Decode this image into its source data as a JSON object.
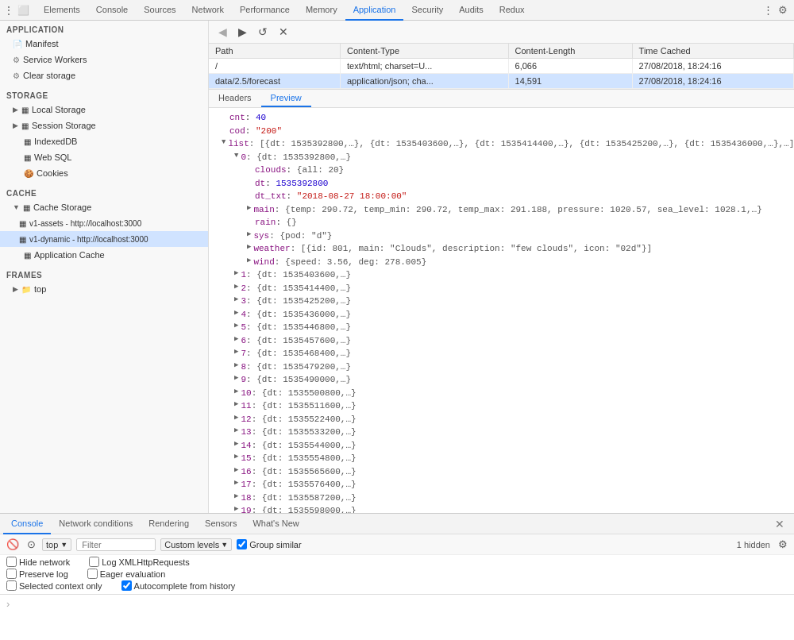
{
  "topTabs": {
    "items": [
      {
        "label": "Elements",
        "active": false
      },
      {
        "label": "Console",
        "active": false
      },
      {
        "label": "Sources",
        "active": false
      },
      {
        "label": "Network",
        "active": false
      },
      {
        "label": "Performance",
        "active": false
      },
      {
        "label": "Memory",
        "active": false
      },
      {
        "label": "Application",
        "active": true
      },
      {
        "label": "Security",
        "active": false
      },
      {
        "label": "Audits",
        "active": false
      },
      {
        "label": "Redux",
        "active": false
      }
    ]
  },
  "sidebar": {
    "applicationLabel": "Application",
    "items": [
      {
        "label": "Manifest",
        "icon": "doc",
        "indent": 0,
        "type": "app"
      },
      {
        "label": "Service Workers",
        "icon": "gear",
        "indent": 0,
        "type": "app"
      },
      {
        "label": "Clear storage",
        "icon": "gear",
        "indent": 0,
        "type": "app"
      }
    ],
    "storageLabel": "Storage",
    "storageItems": [
      {
        "label": "Local Storage",
        "icon": "db",
        "indent": 0,
        "expanded": true
      },
      {
        "label": "Session Storage",
        "icon": "db",
        "indent": 0,
        "expanded": true
      },
      {
        "label": "IndexedDB",
        "icon": "db",
        "indent": 0
      },
      {
        "label": "Web SQL",
        "icon": "db",
        "indent": 0
      },
      {
        "label": "Cookies",
        "icon": "cookie",
        "indent": 0
      }
    ],
    "cacheLabel": "Cache",
    "cacheItems": [
      {
        "label": "Cache Storage",
        "icon": "db",
        "indent": 0,
        "expanded": true
      },
      {
        "label": "v1-assets - http://localhost:3000",
        "icon": "db",
        "indent": 1
      },
      {
        "label": "v1-dynamic - http://localhost:3000",
        "icon": "db",
        "indent": 1,
        "selected": true
      },
      {
        "label": "Application Cache",
        "icon": "db",
        "indent": 0
      }
    ],
    "framesLabel": "Frames",
    "framesItems": [
      {
        "label": "top",
        "indent": 0,
        "expanded": false
      }
    ]
  },
  "cacheTable": {
    "columns": [
      "Path",
      "Content-Type",
      "Content-Length",
      "Time Cached"
    ],
    "rows": [
      {
        "path": "/",
        "contentType": "text/html; charset=U...",
        "contentLength": "6,066",
        "timeCached": "27/08/2018, 18:24:16"
      },
      {
        "path": "data/2.5/forecast",
        "contentType": "application/json; cha...",
        "contentLength": "14,591",
        "timeCached": "27/08/2018, 18:24:16"
      }
    ]
  },
  "previewTabs": [
    "Headers",
    "Preview"
  ],
  "activePreviewTab": "Preview",
  "jsonPreview": {
    "lines": [
      {
        "indent": 0,
        "text": "cnt: 40",
        "type": "keyval",
        "key": "cnt",
        "val": " 40",
        "valType": "number"
      },
      {
        "indent": 0,
        "text": "cod: \"200\"",
        "type": "keyval",
        "key": "cod",
        "val": " \"200\"",
        "valType": "string"
      },
      {
        "indent": 0,
        "text": "list: [{dt: 1535392800,…}, {dt: 1535403600,…}, {dt: 1535414400,…}, {dt: 1535425200,…}, {dt: 1535436000,…},…]",
        "type": "expandable",
        "expanded": true
      },
      {
        "indent": 1,
        "text": "0: {dt: 1535392800,…}",
        "type": "expandable",
        "expanded": true
      },
      {
        "indent": 2,
        "text": "clouds: {all: 20}",
        "type": "keyval",
        "key": "clouds",
        "val": " {all: 20}",
        "valType": "expand"
      },
      {
        "indent": 2,
        "text": "dt: 1535392800",
        "type": "keyval",
        "key": "dt",
        "val": " 1535392800",
        "valType": "number"
      },
      {
        "indent": 2,
        "text": "dt_txt: \"2018-08-27 18:00:00\"",
        "type": "keyval",
        "key": "dt_txt",
        "val": " \"2018-08-27 18:00:00\"",
        "valType": "string"
      },
      {
        "indent": 2,
        "text": "main: {temp: 290.72, temp_min: 290.72, temp_max: 291.188, pressure: 1020.57, sea_level: 1028.1,…}",
        "type": "expandable",
        "expanded": false
      },
      {
        "indent": 2,
        "text": "rain: {}",
        "type": "keyval",
        "key": "rain",
        "val": " {}",
        "valType": "expand"
      },
      {
        "indent": 2,
        "text": "sys: {pod: \"d\"}",
        "type": "expandable",
        "expanded": false
      },
      {
        "indent": 2,
        "text": "weather: [{id: 801, main: \"Clouds\", description: \"few clouds\", icon: \"02d\"}]",
        "type": "expandable",
        "expanded": false
      },
      {
        "indent": 2,
        "text": "wind: {speed: 3.56, deg: 278.005}",
        "type": "expandable",
        "expanded": false
      },
      {
        "indent": 1,
        "text": "1: {dt: 1535403600,…}",
        "type": "expandable",
        "expanded": false
      },
      {
        "indent": 1,
        "text": "2: {dt: 1535414400,…}",
        "type": "expandable",
        "expanded": false
      },
      {
        "indent": 1,
        "text": "3: {dt: 1535425200,…}",
        "type": "expandable",
        "expanded": false
      },
      {
        "indent": 1,
        "text": "4: {dt: 1535436000,…}",
        "type": "expandable",
        "expanded": false
      },
      {
        "indent": 1,
        "text": "5: {dt: 1535446800,…}",
        "type": "expandable",
        "expanded": false
      },
      {
        "indent": 1,
        "text": "6: {dt: 1535457600,…}",
        "type": "expandable",
        "expanded": false
      },
      {
        "indent": 1,
        "text": "7: {dt: 1535468400,…}",
        "type": "expandable",
        "expanded": false
      },
      {
        "indent": 1,
        "text": "8: {dt: 1535479200,…}",
        "type": "expandable",
        "expanded": false
      },
      {
        "indent": 1,
        "text": "9: {dt: 1535490000,…}",
        "type": "expandable",
        "expanded": false
      },
      {
        "indent": 1,
        "text": "10: {dt: 1535500800,…}",
        "type": "expandable",
        "expanded": false
      },
      {
        "indent": 1,
        "text": "11: {dt: 1535511600,…}",
        "type": "expandable",
        "expanded": false
      },
      {
        "indent": 1,
        "text": "12: {dt: 1535522400,…}",
        "type": "expandable",
        "expanded": false
      },
      {
        "indent": 1,
        "text": "13: {dt: 1535533200,…}",
        "type": "expandable",
        "expanded": false
      },
      {
        "indent": 1,
        "text": "14: {dt: 1535544000,…}",
        "type": "expandable",
        "expanded": false
      },
      {
        "indent": 1,
        "text": "15: {dt: 1535554800,…}",
        "type": "expandable",
        "expanded": false
      },
      {
        "indent": 1,
        "text": "16: {dt: 1535565600,…}",
        "type": "expandable",
        "expanded": false
      },
      {
        "indent": 1,
        "text": "17: {dt: 1535576400,…}",
        "type": "expandable",
        "expanded": false
      },
      {
        "indent": 1,
        "text": "18: {dt: 1535587200,…}",
        "type": "expandable",
        "expanded": false
      },
      {
        "indent": 1,
        "text": "19: {dt: 1535598000,…}",
        "type": "expandable",
        "expanded": false
      }
    ]
  },
  "consoleTabs": [
    "Console",
    "Network conditions",
    "Rendering",
    "Sensors",
    "What's New"
  ],
  "activeConsoleTab": "Console",
  "consoleToolbar": {
    "contextValue": "top",
    "filterPlaceholder": "Filter",
    "levelLabel": "Custom levels",
    "groupSimilarLabel": "Group similar",
    "hiddenCount": "1 hidden",
    "checkboxes": {
      "hideNetwork": "Hide network",
      "preserveLog": "Preserve log",
      "selectedContextOnly": "Selected context only",
      "logXMLHttpRequests": "Log XMLHttpRequests",
      "eagerEvaluation": "Eager evaluation",
      "autocompleteFromHistory": "Autocomplete from history"
    }
  }
}
